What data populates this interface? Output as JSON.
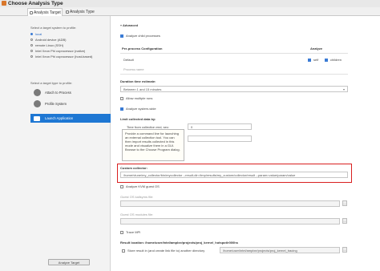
{
  "window": {
    "title": "Choose Analysis Type"
  },
  "tabs": [
    {
      "label": "Analysis Target"
    },
    {
      "label": "Analysis Type"
    }
  ],
  "left": {
    "target_label": "Select a target system to profile:",
    "targets": [
      {
        "label": "local",
        "selected": true
      },
      {
        "label": "Android device (ADB)",
        "selected": false
      },
      {
        "label": "remote Linux (SSH)",
        "selected": false
      },
      {
        "label": "Intel Xeon Phi coprocessor (native)",
        "selected": false
      },
      {
        "label": "Intel Xeon Phi coprocessor (host-based)",
        "selected": false
      }
    ],
    "type_label": "Select a target type to profile:",
    "types": [
      {
        "label": "Attach to Process",
        "icon": "attach-icon",
        "selected": false
      },
      {
        "label": "Profile System",
        "icon": "system-icon",
        "selected": false
      },
      {
        "label": "Launch Application",
        "icon": "launch-icon",
        "selected": true
      }
    ],
    "analyze_button": "Analyze Target"
  },
  "right": {
    "advanced_header": "Advanced",
    "analyze_child": "Analyze child processes",
    "per_process_header": "Per-process Configuration",
    "analyze_col": "Analyze",
    "process_default": "Default",
    "process_placeholder": "Process name",
    "chk_self": "self",
    "chk_children": "children",
    "duration_header": "Duration time estimate:",
    "duration_value": "Between 1 and 15 minutes",
    "allow_multiple": "Allow multiple runs",
    "analyze_system_wide": "Analyze system-wide",
    "limit_data_header": "Limit collected data by:",
    "time_from_label": "Time from collection end, sec:",
    "time_from_value": "0",
    "tooltip": "Provide a command line for launching an external collection tool. You can then import results collected in this mode and visualize them in a GUI. Browse to the Choose Program dialog.",
    "custom_collector_label": "Custom collector:",
    "custom_collector_value": "/home/vtune/my_collector/bin/mycollector --result-dir=/tmp/results/my_custom/collector/result --param=value/param/value",
    "analyze_kvm": "Analyze KVM guest OS",
    "kallsyms_label": "Guest OS kallsyms file:",
    "modules_label": "Guest OS modules file:",
    "trace_mpi": "Trace MPI",
    "result_location_label": "Result location: /home/user/intel/amplxe/projects/proj_kernel_hotspot/r000hs",
    "store_result_label": "Store result in (and create link file to) another directory",
    "store_result_path": "/home/user/intel/amplxe/projects/proj_kernel_tracing",
    "browse": "..."
  },
  "colors": {
    "accent": "#1e77d3",
    "highlight": "#d92020"
  }
}
